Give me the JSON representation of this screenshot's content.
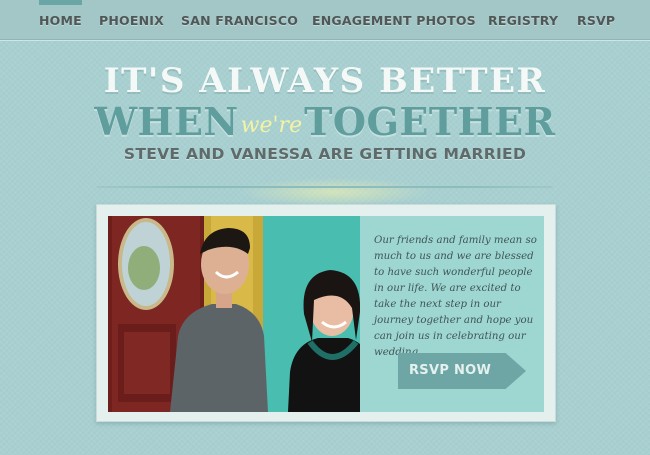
{
  "nav": {
    "items": [
      {
        "label": "HOME",
        "active": true
      },
      {
        "label": "PHOENIX"
      },
      {
        "label": "SAN FRANCISCO"
      },
      {
        "label": "ENGAGEMENT PHOTOS"
      },
      {
        "label": "REGISTRY"
      },
      {
        "label": "RSVP"
      }
    ]
  },
  "headline": {
    "line1": "IT'S ALWAYS BETTER",
    "when": "WHEN",
    "were": "we're",
    "together": "TOGETHER",
    "subtitle": "STEVE AND VANESSA ARE GETTING MARRIED"
  },
  "hero": {
    "body": "Our friends and family mean so much to us and we are blessed to have such wonderful people in our life. We are excited to take the next step in our journey together and hope you can join us in celebrating our wedding.",
    "button_label": "RSVP NOW"
  },
  "colors": {
    "background": "#a9d0d1",
    "accent_teal": "#5f9e9d",
    "highlight_yellow": "#f4f3a4",
    "button": "#6ea6a5"
  }
}
